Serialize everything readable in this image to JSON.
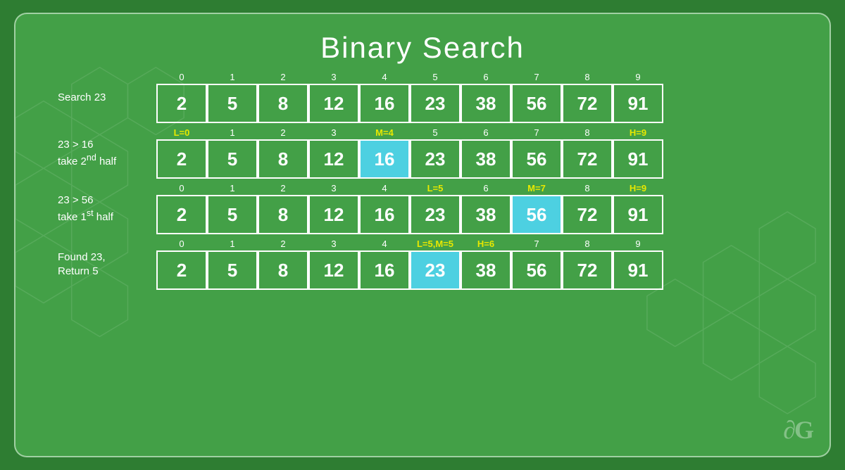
{
  "title": "Binary Search",
  "logo": "∂G",
  "rows": [
    {
      "label": "Search 23",
      "indices": [
        {
          "text": "0",
          "cls": ""
        },
        {
          "text": "1",
          "cls": ""
        },
        {
          "text": "2",
          "cls": ""
        },
        {
          "text": "3",
          "cls": ""
        },
        {
          "text": "4",
          "cls": ""
        },
        {
          "text": "5",
          "cls": ""
        },
        {
          "text": "6",
          "cls": ""
        },
        {
          "text": "7",
          "cls": ""
        },
        {
          "text": "8",
          "cls": ""
        },
        {
          "text": "9",
          "cls": ""
        }
      ],
      "values": [
        {
          "text": "2",
          "cls": ""
        },
        {
          "text": "5",
          "cls": ""
        },
        {
          "text": "8",
          "cls": ""
        },
        {
          "text": "12",
          "cls": ""
        },
        {
          "text": "16",
          "cls": ""
        },
        {
          "text": "23",
          "cls": ""
        },
        {
          "text": "38",
          "cls": ""
        },
        {
          "text": "56",
          "cls": ""
        },
        {
          "text": "72",
          "cls": ""
        },
        {
          "text": "91",
          "cls": ""
        }
      ]
    },
    {
      "label": "23 > 16\ntake 2nd half",
      "indices": [
        {
          "text": "L=0",
          "cls": "yellow"
        },
        {
          "text": "1",
          "cls": ""
        },
        {
          "text": "2",
          "cls": ""
        },
        {
          "text": "3",
          "cls": ""
        },
        {
          "text": "M=4",
          "cls": "yellow"
        },
        {
          "text": "5",
          "cls": ""
        },
        {
          "text": "6",
          "cls": ""
        },
        {
          "text": "7",
          "cls": ""
        },
        {
          "text": "8",
          "cls": ""
        },
        {
          "text": "H=9",
          "cls": "yellow"
        }
      ],
      "values": [
        {
          "text": "2",
          "cls": ""
        },
        {
          "text": "5",
          "cls": ""
        },
        {
          "text": "8",
          "cls": ""
        },
        {
          "text": "12",
          "cls": ""
        },
        {
          "text": "16",
          "cls": "highlight-blue"
        },
        {
          "text": "23",
          "cls": ""
        },
        {
          "text": "38",
          "cls": ""
        },
        {
          "text": "56",
          "cls": ""
        },
        {
          "text": "72",
          "cls": ""
        },
        {
          "text": "91",
          "cls": ""
        }
      ]
    },
    {
      "label": "23 > 56\ntake 1st half",
      "indices": [
        {
          "text": "0",
          "cls": ""
        },
        {
          "text": "1",
          "cls": ""
        },
        {
          "text": "2",
          "cls": ""
        },
        {
          "text": "3",
          "cls": ""
        },
        {
          "text": "4",
          "cls": ""
        },
        {
          "text": "L=5",
          "cls": "yellow"
        },
        {
          "text": "6",
          "cls": ""
        },
        {
          "text": "M=7",
          "cls": "yellow"
        },
        {
          "text": "8",
          "cls": ""
        },
        {
          "text": "H=9",
          "cls": "yellow"
        }
      ],
      "values": [
        {
          "text": "2",
          "cls": ""
        },
        {
          "text": "5",
          "cls": ""
        },
        {
          "text": "8",
          "cls": ""
        },
        {
          "text": "12",
          "cls": ""
        },
        {
          "text": "16",
          "cls": ""
        },
        {
          "text": "23",
          "cls": ""
        },
        {
          "text": "38",
          "cls": ""
        },
        {
          "text": "56",
          "cls": "highlight-blue"
        },
        {
          "text": "72",
          "cls": ""
        },
        {
          "text": "91",
          "cls": ""
        }
      ]
    },
    {
      "label": "Found 23,\nReturn 5",
      "indices": [
        {
          "text": "0",
          "cls": ""
        },
        {
          "text": "1",
          "cls": ""
        },
        {
          "text": "2",
          "cls": ""
        },
        {
          "text": "3",
          "cls": ""
        },
        {
          "text": "4",
          "cls": ""
        },
        {
          "text": "L=5,M=5",
          "cls": "yellow"
        },
        {
          "text": "H=6",
          "cls": "yellow"
        },
        {
          "text": "7",
          "cls": ""
        },
        {
          "text": "8",
          "cls": ""
        },
        {
          "text": "9",
          "cls": ""
        }
      ],
      "values": [
        {
          "text": "2",
          "cls": ""
        },
        {
          "text": "5",
          "cls": ""
        },
        {
          "text": "8",
          "cls": ""
        },
        {
          "text": "12",
          "cls": ""
        },
        {
          "text": "16",
          "cls": ""
        },
        {
          "text": "23",
          "cls": "highlight-blue"
        },
        {
          "text": "38",
          "cls": ""
        },
        {
          "text": "56",
          "cls": ""
        },
        {
          "text": "72",
          "cls": ""
        },
        {
          "text": "91",
          "cls": ""
        }
      ]
    }
  ]
}
